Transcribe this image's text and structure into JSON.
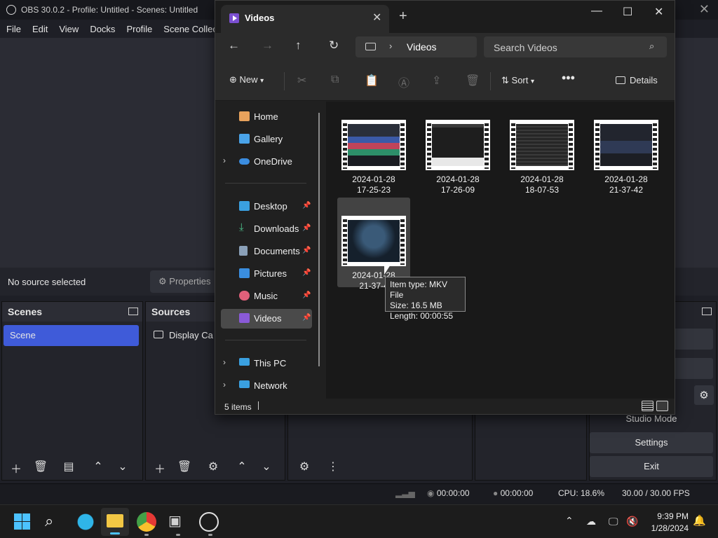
{
  "obs": {
    "title": "OBS 30.0.2 - Profile: Untitled - Scenes: Untitled",
    "menu": [
      "File",
      "Edit",
      "View",
      "Docks",
      "Profile",
      "Scene Collec"
    ],
    "no_source": "No source selected",
    "properties": "Properties",
    "scenes_title": "Scenes",
    "sources_title": "Sources",
    "scene_item": "Scene",
    "source_item": "Display Ca",
    "controls": {
      "partial1": "ng",
      "partial2": "ng",
      "studio": "Studio Mode",
      "settings": "Settings",
      "exit": "Exit"
    },
    "status": {
      "time1": "00:00:00",
      "time2": "00:00:00",
      "cpu": "CPU: 18.6%",
      "fps": "30.00 / 30.00 FPS"
    }
  },
  "explorer": {
    "tab_title": "Videos",
    "address": "Videos",
    "search_placeholder": "Search Videos",
    "commands": {
      "new": "New",
      "sort": "Sort",
      "details": "Details"
    },
    "nav": [
      {
        "label": "Home",
        "icon": "home-icon",
        "color": "#e8a25c"
      },
      {
        "label": "Gallery",
        "icon": "gallery-icon",
        "color": "#4aa3e8"
      },
      {
        "label": "OneDrive",
        "icon": "cloud-icon",
        "color": "#3b8de0"
      },
      {
        "label": "Desktop",
        "icon": "desktop-icon",
        "color": "#3aa0e0"
      },
      {
        "label": "Downloads",
        "icon": "download-icon",
        "color": "#4cc08a"
      },
      {
        "label": "Documents",
        "icon": "document-icon",
        "color": "#8aa0b8"
      },
      {
        "label": "Pictures",
        "icon": "pictures-icon",
        "color": "#3a8ee0"
      },
      {
        "label": "Music",
        "icon": "music-icon",
        "color": "#e0607a"
      },
      {
        "label": "Videos",
        "icon": "videos-icon",
        "color": "#8a5ad8"
      },
      {
        "label": "This PC",
        "icon": "pc-icon",
        "color": "#3aa0e0"
      },
      {
        "label": "Network",
        "icon": "network-icon",
        "color": "#3aa0e0"
      }
    ],
    "files": [
      {
        "line1": "2024-01-28",
        "line2": "17-25-23"
      },
      {
        "line1": "2024-01-28",
        "line2": "17-26-09"
      },
      {
        "line1": "2024-01-28",
        "line2": "18-07-53"
      },
      {
        "line1": "2024-01-28",
        "line2": "21-37-42"
      },
      {
        "line1": "2024-01-28",
        "line2": "21-37-4"
      }
    ],
    "tooltip": {
      "type": "Item type: MKV File",
      "size": "Size: 16.5 MB",
      "length": "Length: 00:00:55"
    },
    "item_count": "5 items"
  },
  "taskbar": {
    "time": "9:39 PM",
    "date": "1/28/2024"
  }
}
